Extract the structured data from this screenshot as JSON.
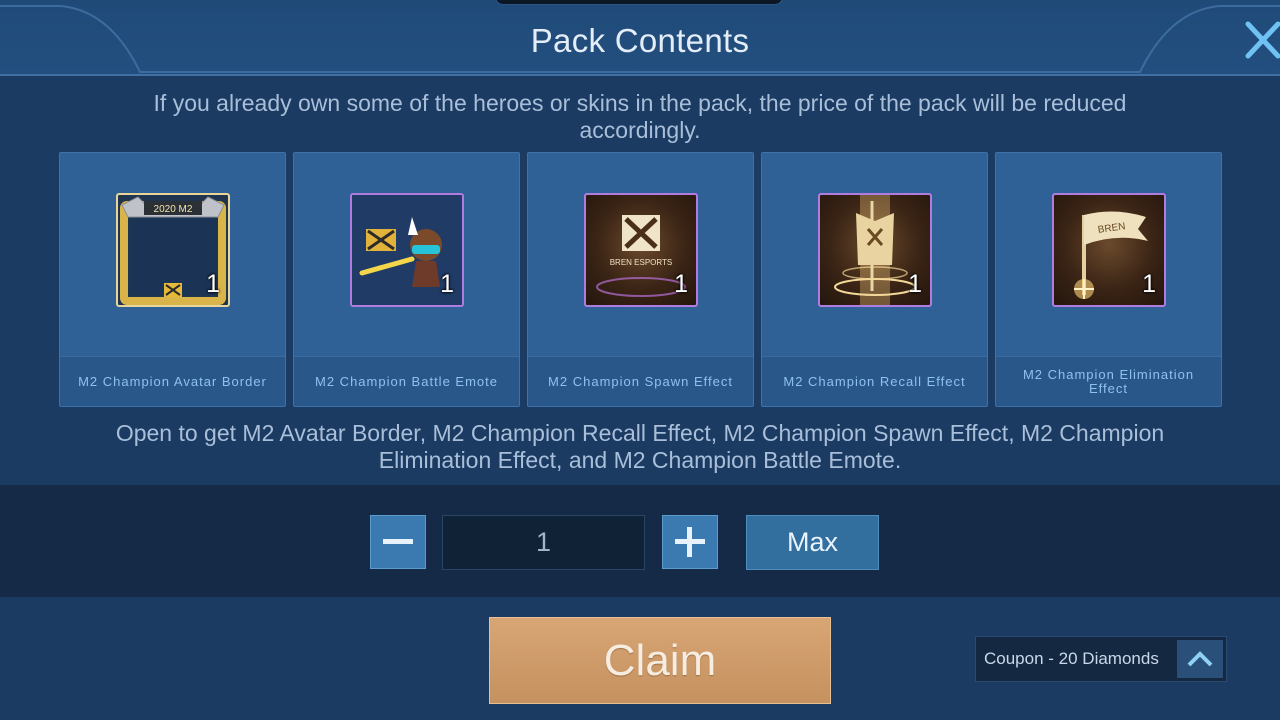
{
  "header": {
    "title": "Pack Contents"
  },
  "note": "If you already own some of the heroes or skins in the pack, the price of the pack will be reduced accordingly.",
  "items": [
    {
      "name": "M2 Champion Avatar Border",
      "quantity": "1",
      "icon": "avatar-border-icon",
      "art_text": "2020 M2"
    },
    {
      "name": "M2 Champion Battle Emote",
      "quantity": "1",
      "icon": "battle-emote-icon"
    },
    {
      "name": "M2 Champion Spawn Effect",
      "quantity": "1",
      "icon": "spawn-effect-icon",
      "art_text": "BREN ESPORTS"
    },
    {
      "name": "M2 Champion Recall Effect",
      "quantity": "1",
      "icon": "recall-effect-icon"
    },
    {
      "name": "M2 Champion Elimination Effect",
      "quantity": "1",
      "icon": "elimination-effect-icon",
      "art_text": "BREN"
    }
  ],
  "description": "Open to get M2 Avatar Border, M2 Champion Recall Effect, M2 Champion Spawn Effect, M2 Champion Elimination Effect, and M2 Champion Battle Emote.",
  "quantity_selector": {
    "value": "1",
    "max_label": "Max"
  },
  "claim_label": "Claim",
  "coupon": {
    "label": "Coupon - 20 Diamonds"
  },
  "colors": {
    "background": "#1b3b63",
    "card": "#2e5f96",
    "claim": "#d8a574",
    "rare_border": "#b07ce0",
    "gold_border": "#e8d59a"
  }
}
